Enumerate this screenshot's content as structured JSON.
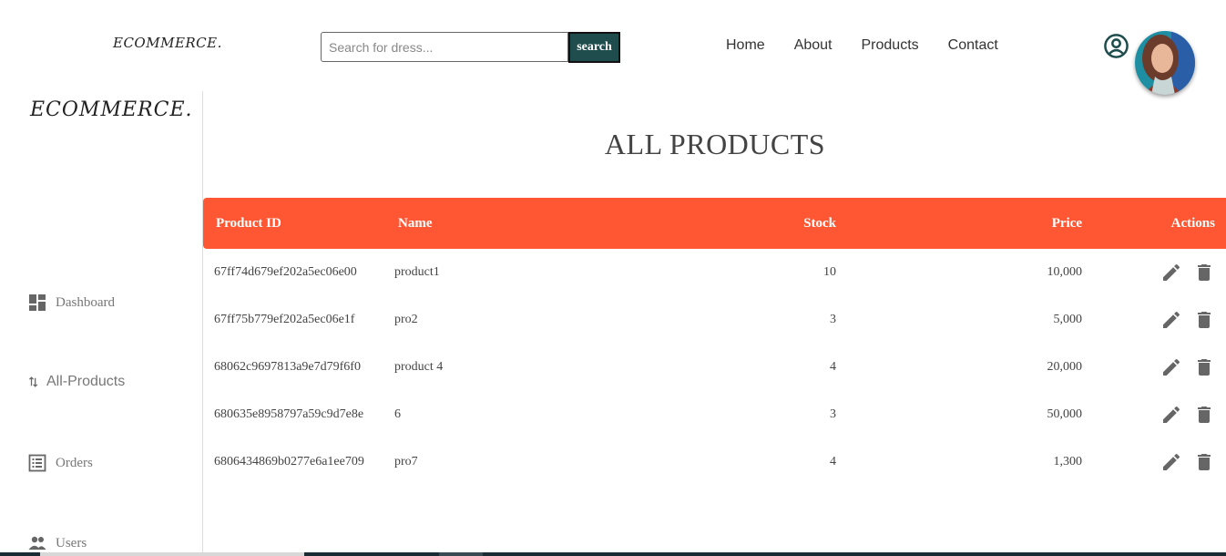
{
  "header": {
    "logo": "ECOMMERCE.",
    "search": {
      "placeholder": "Search for dress...",
      "value": "",
      "button_label": "search"
    },
    "nav": [
      "Home",
      "About",
      "Products",
      "Contact"
    ]
  },
  "sidebar": {
    "logo": "ECOMMERCE.",
    "items": [
      {
        "label": "Dashboard",
        "icon": "dashboard-icon"
      },
      {
        "label": "All-Products",
        "icon": "swap-vertical-icon"
      },
      {
        "label": "Orders",
        "icon": "list-icon"
      },
      {
        "label": "Users",
        "icon": "people-icon"
      }
    ]
  },
  "main": {
    "title": "ALL PRODUCTS",
    "columns": [
      "Product ID",
      "Name",
      "Stock",
      "Price",
      "Actions"
    ],
    "rows": [
      {
        "id": "67ff74d679ef202a5ec06e00",
        "name": "product1",
        "stock": "10",
        "price": "10,000"
      },
      {
        "id": "67ff75b779ef202a5ec06e1f",
        "name": "pro2",
        "stock": "3",
        "price": "5,000"
      },
      {
        "id": "68062c9697813a9e7d79f6f0",
        "name": "product 4",
        "stock": "4",
        "price": "20,000"
      },
      {
        "id": "680635e8958797a59c9d7e8e",
        "name": "6",
        "stock": "3",
        "price": "50,000"
      },
      {
        "id": "6806434869b0277e6a1ee709",
        "name": "pro7",
        "stock": "4",
        "price": "1,300"
      }
    ]
  },
  "colors": {
    "header_bg": "#ff5733",
    "search_btn": "#1f4d4d",
    "icon": "#666666"
  }
}
